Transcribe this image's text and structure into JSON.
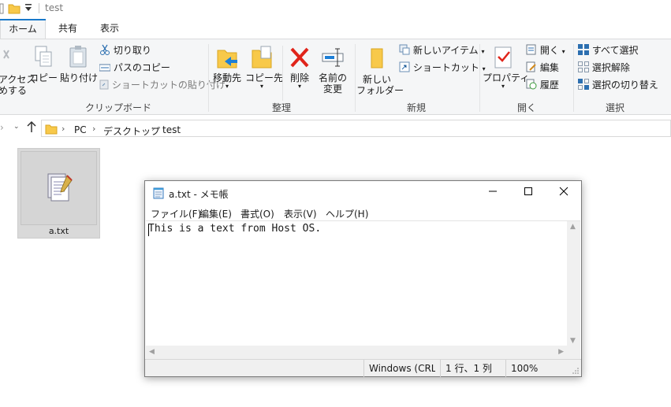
{
  "explorer": {
    "window_title": "test",
    "tabs": [
      {
        "label": "ホーム"
      },
      {
        "label": "共有"
      },
      {
        "label": "表示"
      }
    ],
    "ribbon": {
      "clipboard": {
        "quick_access_label_1": "アクセス",
        "quick_access_label_2": "めする",
        "copy": "コピー",
        "paste": "貼り付け",
        "cut": "切り取り",
        "copy_path": "パスのコピー",
        "paste_shortcut": "ショートカットの貼り付け",
        "group_label": "クリップボード"
      },
      "organize": {
        "move_to": "移動先",
        "copy_to": "コピー先",
        "delete": "削除",
        "rename_1": "名前の",
        "rename_2": "変更",
        "group_label": "整理"
      },
      "new": {
        "new_folder_1": "新しい",
        "new_folder_2": "フォルダー",
        "new_item": "新しいアイテム",
        "shortcut": "ショートカット",
        "group_label": "新規"
      },
      "open": {
        "properties": "プロパティ",
        "open": "開く",
        "edit": "編集",
        "history": "履歴",
        "group_label": "開く"
      },
      "select": {
        "select_all": "すべて選択",
        "select_none": "選択解除",
        "invert": "選択の切り替え",
        "group_label": "選択"
      }
    },
    "address": {
      "crumbs": [
        "PC",
        "デスクトップ",
        "test"
      ]
    },
    "files": [
      {
        "name": "a.txt"
      }
    ]
  },
  "notepad": {
    "title": "a.txt - メモ帳",
    "menu": [
      "ファイル(F)",
      "編集(E)",
      "書式(O)",
      "表示(V)",
      "ヘルプ(H)"
    ],
    "content": "This is a text from Host OS.",
    "status": {
      "encoding": "Windows (CRLF)",
      "position": "1 行、1 列",
      "zoom": "100%"
    }
  },
  "colors": {
    "accent": "#1979ca",
    "ribbon_bg": "#f5f6f7",
    "delete_red": "#e0241a",
    "folder_yellow": "#f8c94a"
  }
}
